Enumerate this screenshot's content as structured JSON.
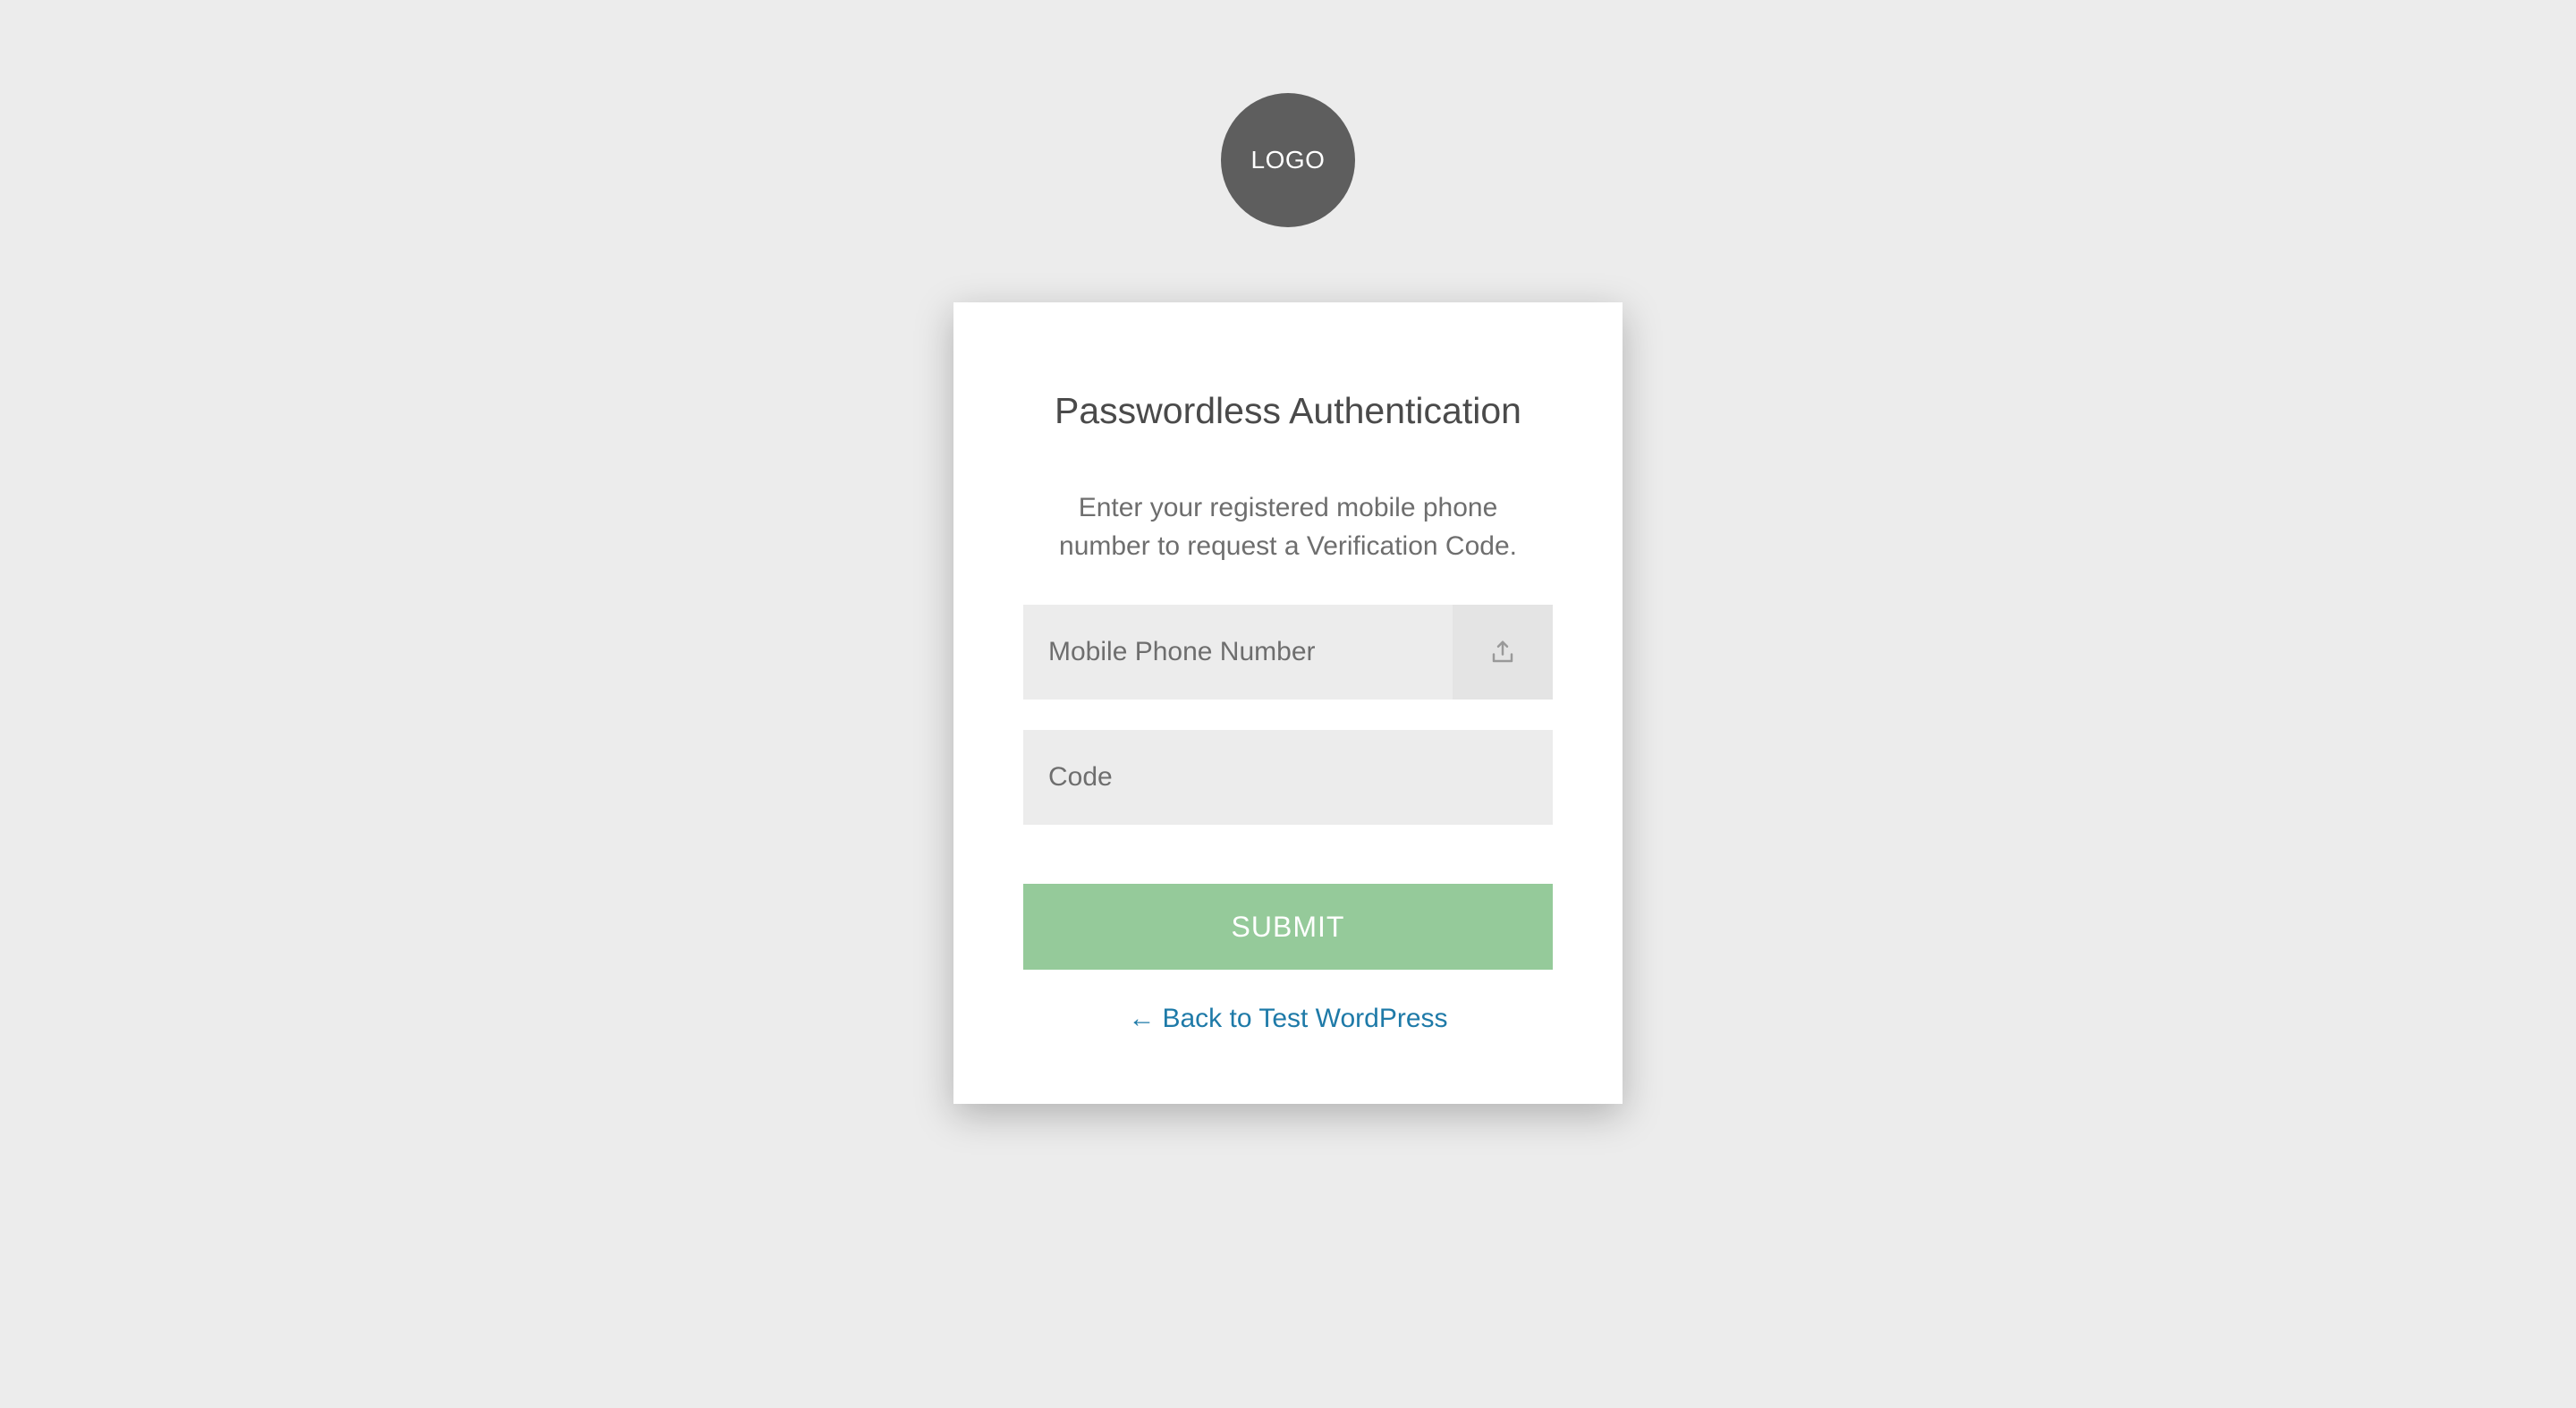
{
  "logo": {
    "text": "LOGO"
  },
  "card": {
    "title": "Passwordless Authentication",
    "instruction": "Enter your registered mobile phone number to request a Verification Code.",
    "phone_placeholder": "Mobile Phone Number",
    "code_placeholder": "Code",
    "submit_label": "SUBMIT",
    "back_arrow": "←",
    "back_link_text": "Back to Test WordPress"
  }
}
